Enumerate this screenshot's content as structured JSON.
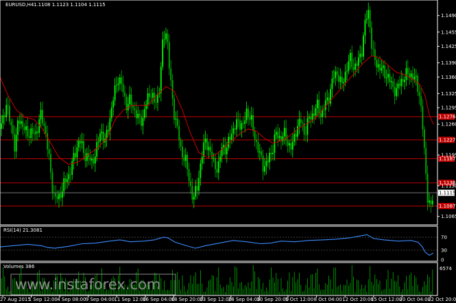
{
  "header": {
    "symbol": "EURUSD,H4",
    "ohlc": "1.1108 1.1123 1.1104 1.1115"
  },
  "watermark": "www.instaforex.com",
  "colors": {
    "background": "#000000",
    "bull": "#00ff00",
    "bear": "#00b400",
    "ma": "#d00000",
    "levels": "#c00000",
    "rsi": "#3c8cff",
    "volume": "#00cc00",
    "axis": "#ffffff"
  },
  "chart_data": [
    {
      "type": "candlestick",
      "pane": "price",
      "title": "EURUSD,H4",
      "ylim": [
        1.105,
        1.152
      ],
      "y_ticks": [
        "1.1065",
        "1.1130",
        "1.1195",
        "1.1260",
        "1.1295",
        "1.1325",
        "1.1360",
        "1.1390",
        "1.1425",
        "1.1455",
        "1.1490"
      ],
      "x_ticks": [
        "27 Aug 2015",
        "1 Sep 12:00",
        "4 Sep 08:00",
        "9 Sep 04:00",
        "11 Sep 12:00",
        "16 Sep 04:00",
        "18 Sep 20:00",
        "23 Sep 12:00",
        "28 Sep 04:00",
        "30 Sep 20:00",
        "5 Oct 12:00",
        "8 Oct 04:00",
        "12 Oct 20:00",
        "15 Oct 12:00",
        "20 Oct 04:00",
        "22 Oct 20:00"
      ],
      "overlay": "moving average",
      "horizontal_levels": [
        {
          "value": 1.1276,
          "label": "1.1276"
        },
        {
          "value": 1.1227,
          "label": "1.1227"
        },
        {
          "value": 1.1187,
          "label": "1.1187"
        },
        {
          "value": 1.1136,
          "label": "1.1136"
        },
        {
          "value": 1.1087,
          "label": "1.1087"
        }
      ],
      "current_price": {
        "value": 1.1115,
        "label": "1.1115"
      },
      "close_path": [
        [
          0,
          1.125
        ],
        [
          9,
          1.13
        ],
        [
          18,
          1.125
        ],
        [
          22,
          1.12
        ],
        [
          27,
          1.128
        ],
        [
          34,
          1.125
        ],
        [
          43,
          1.124
        ],
        [
          52,
          1.124
        ],
        [
          60,
          1.128
        ],
        [
          66,
          1.125
        ],
        [
          72,
          1.118
        ],
        [
          78,
          1.111
        ],
        [
          85,
          1.11
        ],
        [
          92,
          1.113
        ],
        [
          100,
          1.115
        ],
        [
          108,
          1.119
        ],
        [
          116,
          1.123
        ],
        [
          122,
          1.12
        ],
        [
          128,
          1.119
        ],
        [
          134,
          1.118
        ],
        [
          140,
          1.12
        ],
        [
          147,
          1.125
        ],
        [
          153,
          1.122
        ],
        [
          160,
          1.127
        ],
        [
          166,
          1.132
        ],
        [
          172,
          1.136
        ],
        [
          178,
          1.134
        ],
        [
          184,
          1.13
        ],
        [
          190,
          1.131
        ],
        [
          196,
          1.129
        ],
        [
          202,
          1.127
        ],
        [
          208,
          1.127
        ],
        [
          214,
          1.131
        ],
        [
          220,
          1.133
        ],
        [
          226,
          1.13
        ],
        [
          232,
          1.133
        ],
        [
          238,
          1.144
        ],
        [
          243,
          1.146
        ],
        [
          248,
          1.136
        ],
        [
          253,
          1.129
        ],
        [
          258,
          1.126
        ],
        [
          264,
          1.12
        ],
        [
          270,
          1.119
        ],
        [
          276,
          1.114
        ],
        [
          282,
          1.11
        ],
        [
          288,
          1.113
        ],
        [
          294,
          1.119
        ],
        [
          300,
          1.123
        ],
        [
          306,
          1.12
        ],
        [
          312,
          1.118
        ],
        [
          318,
          1.116
        ],
        [
          324,
          1.122
        ],
        [
          330,
          1.12
        ],
        [
          336,
          1.124
        ],
        [
          342,
          1.125
        ],
        [
          348,
          1.127
        ],
        [
          354,
          1.125
        ],
        [
          360,
          1.129
        ],
        [
          366,
          1.127
        ],
        [
          372,
          1.123
        ],
        [
          378,
          1.12
        ],
        [
          384,
          1.117
        ],
        [
          390,
          1.118
        ],
        [
          396,
          1.12
        ],
        [
          402,
          1.124
        ],
        [
          408,
          1.123
        ],
        [
          414,
          1.124
        ],
        [
          420,
          1.122
        ],
        [
          426,
          1.121
        ],
        [
          432,
          1.125
        ],
        [
          438,
          1.127
        ],
        [
          444,
          1.124
        ],
        [
          450,
          1.127
        ],
        [
          456,
          1.128
        ],
        [
          462,
          1.13
        ],
        [
          468,
          1.128
        ],
        [
          474,
          1.13
        ],
        [
          480,
          1.132
        ],
        [
          486,
          1.136
        ],
        [
          492,
          1.137
        ],
        [
          498,
          1.134
        ],
        [
          504,
          1.137
        ],
        [
          510,
          1.14
        ],
        [
          516,
          1.138
        ],
        [
          522,
          1.139
        ],
        [
          528,
          1.142
        ],
        [
          533,
          1.148
        ],
        [
          538,
          1.15
        ],
        [
          543,
          1.141
        ],
        [
          548,
          1.139
        ],
        [
          554,
          1.138
        ],
        [
          560,
          1.137
        ],
        [
          566,
          1.136
        ],
        [
          572,
          1.134
        ],
        [
          578,
          1.133
        ],
        [
          584,
          1.135
        ],
        [
          590,
          1.136
        ],
        [
          596,
          1.137
        ],
        [
          602,
          1.136
        ],
        [
          608,
          1.135
        ],
        [
          612,
          1.132
        ],
        [
          616,
          1.126
        ],
        [
          620,
          1.118
        ],
        [
          624,
          1.11
        ],
        [
          628,
          1.108
        ],
        [
          632,
          1.1115
        ]
      ],
      "ma_path": [
        [
          0,
          1.136
        ],
        [
          12,
          1.132
        ],
        [
          24,
          1.129
        ],
        [
          36,
          1.1275
        ],
        [
          50,
          1.127
        ],
        [
          62,
          1.125
        ],
        [
          74,
          1.122
        ],
        [
          86,
          1.119
        ],
        [
          100,
          1.1175
        ],
        [
          114,
          1.118
        ],
        [
          128,
          1.1195
        ],
        [
          142,
          1.121
        ],
        [
          156,
          1.123
        ],
        [
          168,
          1.127
        ],
        [
          180,
          1.129
        ],
        [
          192,
          1.13
        ],
        [
          204,
          1.13
        ],
        [
          216,
          1.13
        ],
        [
          228,
          1.132
        ],
        [
          242,
          1.134
        ],
        [
          254,
          1.133
        ],
        [
          266,
          1.129
        ],
        [
          278,
          1.124
        ],
        [
          290,
          1.12
        ],
        [
          302,
          1.119
        ],
        [
          314,
          1.1195
        ],
        [
          326,
          1.121
        ],
        [
          338,
          1.1225
        ],
        [
          350,
          1.124
        ],
        [
          362,
          1.125
        ],
        [
          374,
          1.1245
        ],
        [
          386,
          1.123
        ],
        [
          398,
          1.122
        ],
        [
          410,
          1.1225
        ],
        [
          422,
          1.1235
        ],
        [
          434,
          1.125
        ],
        [
          446,
          1.126
        ],
        [
          458,
          1.127
        ],
        [
          470,
          1.129
        ],
        [
          482,
          1.131
        ],
        [
          494,
          1.133
        ],
        [
          506,
          1.135
        ],
        [
          518,
          1.137
        ],
        [
          530,
          1.139
        ],
        [
          542,
          1.1405
        ],
        [
          554,
          1.14
        ],
        [
          566,
          1.1385
        ],
        [
          578,
          1.137
        ],
        [
          590,
          1.1365
        ],
        [
          602,
          1.1355
        ],
        [
          612,
          1.1345
        ],
        [
          620,
          1.132
        ],
        [
          626,
          1.128
        ],
        [
          632,
          1.126
        ]
      ]
    },
    {
      "type": "line",
      "pane": "rsi",
      "title": "RSI(14) 21.3081",
      "ylim": [
        0,
        100
      ],
      "y_ticks": [
        "70",
        "30",
        "0"
      ],
      "levels": [
        70,
        30
      ],
      "series": [
        {
          "name": "RSI(14)",
          "values": [
            [
              0,
              40
            ],
            [
              20,
              44
            ],
            [
              40,
              48
            ],
            [
              60,
              44
            ],
            [
              70,
              38
            ],
            [
              80,
              36
            ],
            [
              100,
              42
            ],
            [
              120,
              50
            ],
            [
              140,
              52
            ],
            [
              160,
              58
            ],
            [
              175,
              62
            ],
            [
              190,
              56
            ],
            [
              210,
              58
            ],
            [
              225,
              62
            ],
            [
              238,
              70
            ],
            [
              245,
              68
            ],
            [
              255,
              55
            ],
            [
              270,
              45
            ],
            [
              285,
              36
            ],
            [
              300,
              44
            ],
            [
              320,
              52
            ],
            [
              340,
              60
            ],
            [
              360,
              56
            ],
            [
              380,
              50
            ],
            [
              395,
              52
            ],
            [
              410,
              58
            ],
            [
              430,
              56
            ],
            [
              450,
              60
            ],
            [
              470,
              62
            ],
            [
              490,
              64
            ],
            [
              510,
              68
            ],
            [
              525,
              74
            ],
            [
              535,
              78
            ],
            [
              545,
              66
            ],
            [
              560,
              62
            ],
            [
              580,
              58
            ],
            [
              600,
              60
            ],
            [
              610,
              54
            ],
            [
              616,
              40
            ],
            [
              620,
              24
            ],
            [
              626,
              14
            ],
            [
              632,
              21
            ]
          ]
        }
      ]
    },
    {
      "type": "bar",
      "pane": "volume",
      "title": "Volumes 386",
      "y_ticks": [
        "6574"
      ]
    }
  ]
}
